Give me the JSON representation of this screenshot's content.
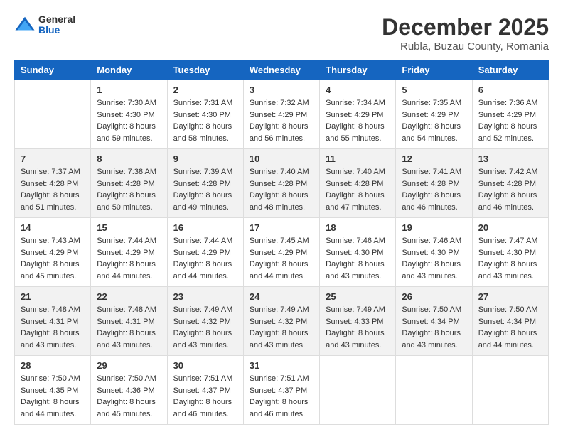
{
  "header": {
    "logo": {
      "general": "General",
      "blue": "Blue"
    },
    "month_year": "December 2025",
    "location": "Rubla, Buzau County, Romania"
  },
  "weekdays": [
    "Sunday",
    "Monday",
    "Tuesday",
    "Wednesday",
    "Thursday",
    "Friday",
    "Saturday"
  ],
  "weeks": [
    [
      {
        "day": "",
        "sunrise": "",
        "sunset": "",
        "daylight": ""
      },
      {
        "day": "1",
        "sunrise": "Sunrise: 7:30 AM",
        "sunset": "Sunset: 4:30 PM",
        "daylight": "Daylight: 8 hours and 59 minutes."
      },
      {
        "day": "2",
        "sunrise": "Sunrise: 7:31 AM",
        "sunset": "Sunset: 4:30 PM",
        "daylight": "Daylight: 8 hours and 58 minutes."
      },
      {
        "day": "3",
        "sunrise": "Sunrise: 7:32 AM",
        "sunset": "Sunset: 4:29 PM",
        "daylight": "Daylight: 8 hours and 56 minutes."
      },
      {
        "day": "4",
        "sunrise": "Sunrise: 7:34 AM",
        "sunset": "Sunset: 4:29 PM",
        "daylight": "Daylight: 8 hours and 55 minutes."
      },
      {
        "day": "5",
        "sunrise": "Sunrise: 7:35 AM",
        "sunset": "Sunset: 4:29 PM",
        "daylight": "Daylight: 8 hours and 54 minutes."
      },
      {
        "day": "6",
        "sunrise": "Sunrise: 7:36 AM",
        "sunset": "Sunset: 4:29 PM",
        "daylight": "Daylight: 8 hours and 52 minutes."
      }
    ],
    [
      {
        "day": "7",
        "sunrise": "Sunrise: 7:37 AM",
        "sunset": "Sunset: 4:28 PM",
        "daylight": "Daylight: 8 hours and 51 minutes."
      },
      {
        "day": "8",
        "sunrise": "Sunrise: 7:38 AM",
        "sunset": "Sunset: 4:28 PM",
        "daylight": "Daylight: 8 hours and 50 minutes."
      },
      {
        "day": "9",
        "sunrise": "Sunrise: 7:39 AM",
        "sunset": "Sunset: 4:28 PM",
        "daylight": "Daylight: 8 hours and 49 minutes."
      },
      {
        "day": "10",
        "sunrise": "Sunrise: 7:40 AM",
        "sunset": "Sunset: 4:28 PM",
        "daylight": "Daylight: 8 hours and 48 minutes."
      },
      {
        "day": "11",
        "sunrise": "Sunrise: 7:40 AM",
        "sunset": "Sunset: 4:28 PM",
        "daylight": "Daylight: 8 hours and 47 minutes."
      },
      {
        "day": "12",
        "sunrise": "Sunrise: 7:41 AM",
        "sunset": "Sunset: 4:28 PM",
        "daylight": "Daylight: 8 hours and 46 minutes."
      },
      {
        "day": "13",
        "sunrise": "Sunrise: 7:42 AM",
        "sunset": "Sunset: 4:28 PM",
        "daylight": "Daylight: 8 hours and 46 minutes."
      }
    ],
    [
      {
        "day": "14",
        "sunrise": "Sunrise: 7:43 AM",
        "sunset": "Sunset: 4:29 PM",
        "daylight": "Daylight: 8 hours and 45 minutes."
      },
      {
        "day": "15",
        "sunrise": "Sunrise: 7:44 AM",
        "sunset": "Sunset: 4:29 PM",
        "daylight": "Daylight: 8 hours and 44 minutes."
      },
      {
        "day": "16",
        "sunrise": "Sunrise: 7:44 AM",
        "sunset": "Sunset: 4:29 PM",
        "daylight": "Daylight: 8 hours and 44 minutes."
      },
      {
        "day": "17",
        "sunrise": "Sunrise: 7:45 AM",
        "sunset": "Sunset: 4:29 PM",
        "daylight": "Daylight: 8 hours and 44 minutes."
      },
      {
        "day": "18",
        "sunrise": "Sunrise: 7:46 AM",
        "sunset": "Sunset: 4:30 PM",
        "daylight": "Daylight: 8 hours and 43 minutes."
      },
      {
        "day": "19",
        "sunrise": "Sunrise: 7:46 AM",
        "sunset": "Sunset: 4:30 PM",
        "daylight": "Daylight: 8 hours and 43 minutes."
      },
      {
        "day": "20",
        "sunrise": "Sunrise: 7:47 AM",
        "sunset": "Sunset: 4:30 PM",
        "daylight": "Daylight: 8 hours and 43 minutes."
      }
    ],
    [
      {
        "day": "21",
        "sunrise": "Sunrise: 7:48 AM",
        "sunset": "Sunset: 4:31 PM",
        "daylight": "Daylight: 8 hours and 43 minutes."
      },
      {
        "day": "22",
        "sunrise": "Sunrise: 7:48 AM",
        "sunset": "Sunset: 4:31 PM",
        "daylight": "Daylight: 8 hours and 43 minutes."
      },
      {
        "day": "23",
        "sunrise": "Sunrise: 7:49 AM",
        "sunset": "Sunset: 4:32 PM",
        "daylight": "Daylight: 8 hours and 43 minutes."
      },
      {
        "day": "24",
        "sunrise": "Sunrise: 7:49 AM",
        "sunset": "Sunset: 4:32 PM",
        "daylight": "Daylight: 8 hours and 43 minutes."
      },
      {
        "day": "25",
        "sunrise": "Sunrise: 7:49 AM",
        "sunset": "Sunset: 4:33 PM",
        "daylight": "Daylight: 8 hours and 43 minutes."
      },
      {
        "day": "26",
        "sunrise": "Sunrise: 7:50 AM",
        "sunset": "Sunset: 4:34 PM",
        "daylight": "Daylight: 8 hours and 43 minutes."
      },
      {
        "day": "27",
        "sunrise": "Sunrise: 7:50 AM",
        "sunset": "Sunset: 4:34 PM",
        "daylight": "Daylight: 8 hours and 44 minutes."
      }
    ],
    [
      {
        "day": "28",
        "sunrise": "Sunrise: 7:50 AM",
        "sunset": "Sunset: 4:35 PM",
        "daylight": "Daylight: 8 hours and 44 minutes."
      },
      {
        "day": "29",
        "sunrise": "Sunrise: 7:50 AM",
        "sunset": "Sunset: 4:36 PM",
        "daylight": "Daylight: 8 hours and 45 minutes."
      },
      {
        "day": "30",
        "sunrise": "Sunrise: 7:51 AM",
        "sunset": "Sunset: 4:37 PM",
        "daylight": "Daylight: 8 hours and 46 minutes."
      },
      {
        "day": "31",
        "sunrise": "Sunrise: 7:51 AM",
        "sunset": "Sunset: 4:37 PM",
        "daylight": "Daylight: 8 hours and 46 minutes."
      },
      {
        "day": "",
        "sunrise": "",
        "sunset": "",
        "daylight": ""
      },
      {
        "day": "",
        "sunrise": "",
        "sunset": "",
        "daylight": ""
      },
      {
        "day": "",
        "sunrise": "",
        "sunset": "",
        "daylight": ""
      }
    ]
  ]
}
